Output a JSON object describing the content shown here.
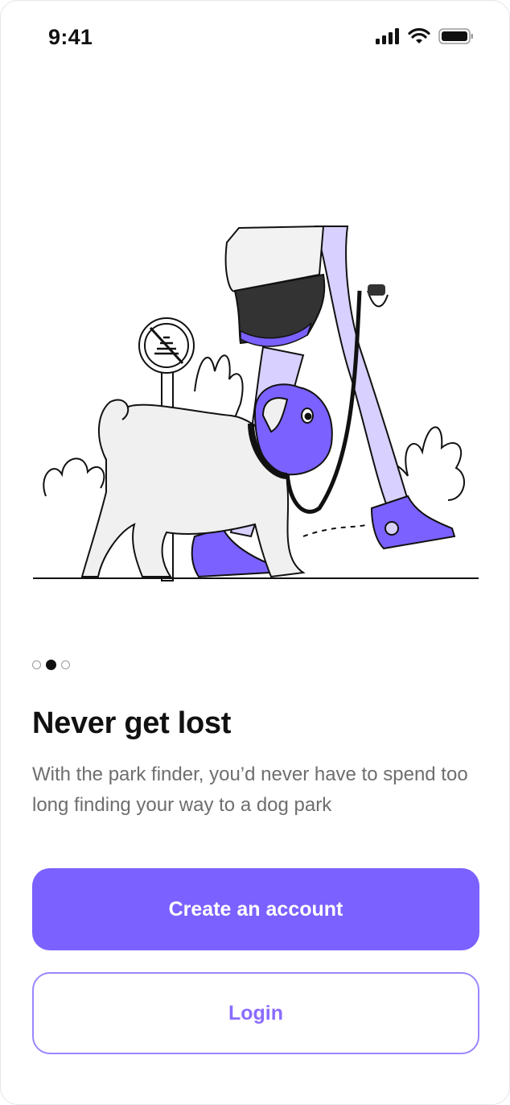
{
  "status_bar": {
    "time": "9:41"
  },
  "onboarding": {
    "page_indicator": {
      "count": 3,
      "active_index": 1
    },
    "title": "Never get lost",
    "description": "With the park finder, you’d never have to spend too long finding your way to a dog park"
  },
  "actions": {
    "create_account_label": "Create an account",
    "login_label": "Login"
  },
  "colors": {
    "accent": "#7b61ff",
    "accent_light": "#d8d0ff",
    "text_primary": "#111111",
    "text_secondary": "#6e6e6e"
  }
}
